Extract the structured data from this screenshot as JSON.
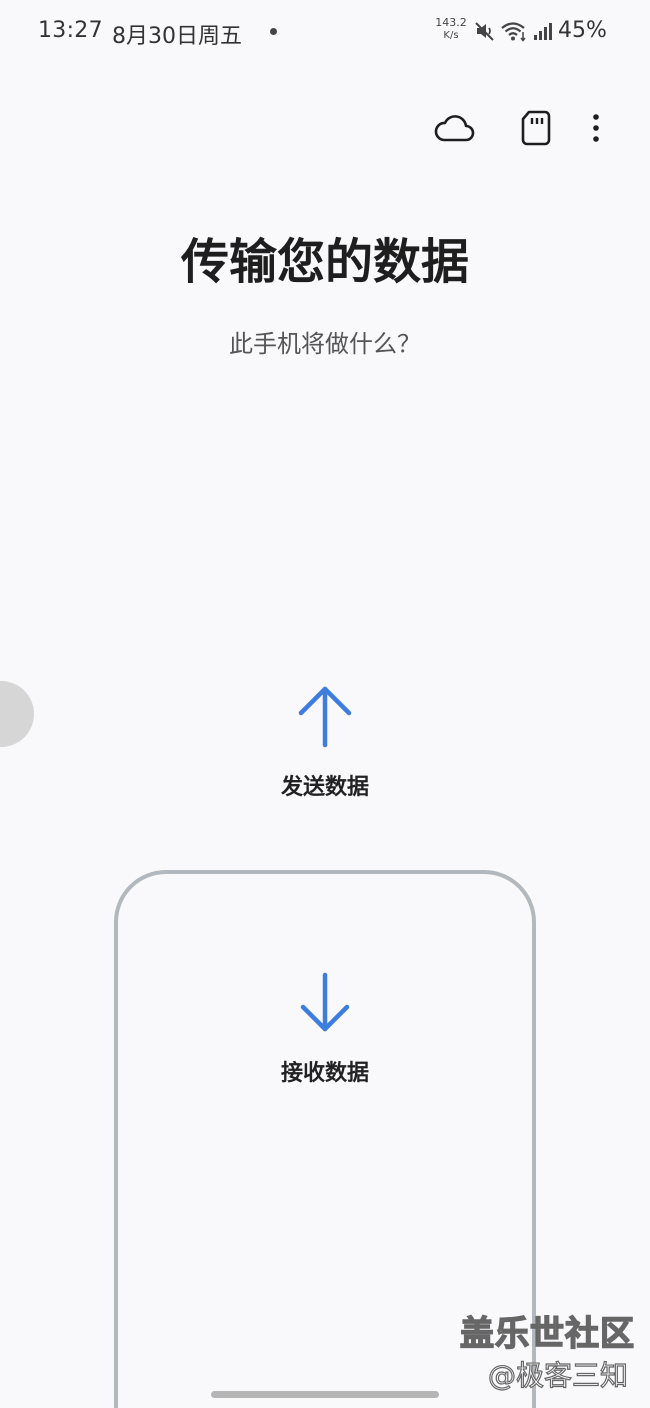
{
  "status_bar": {
    "time": "13:27",
    "date": "8月30日周五",
    "net_speed_value": "143.2",
    "net_speed_unit": "K/s",
    "battery": "45%",
    "icons": [
      "notification-dot",
      "mute-icon",
      "wifi-icon",
      "signal-icon"
    ]
  },
  "toolbar": {
    "icons": [
      "cloud-icon",
      "sd-card-icon",
      "more-options-icon"
    ]
  },
  "page": {
    "title": "传输您的数据",
    "subtitle": "此手机将做什么？"
  },
  "options": {
    "send": {
      "label": "发送数据",
      "icon": "arrow-up-icon"
    },
    "receive": {
      "label": "接收数据",
      "icon": "arrow-down-icon"
    }
  },
  "watermark": {
    "line1": "盖乐世社区",
    "line2": "@极客三知"
  },
  "colors": {
    "accent": "#3d7de0",
    "background": "#f9f9fc",
    "card_border": "#b3b8be",
    "text": "#222222"
  }
}
